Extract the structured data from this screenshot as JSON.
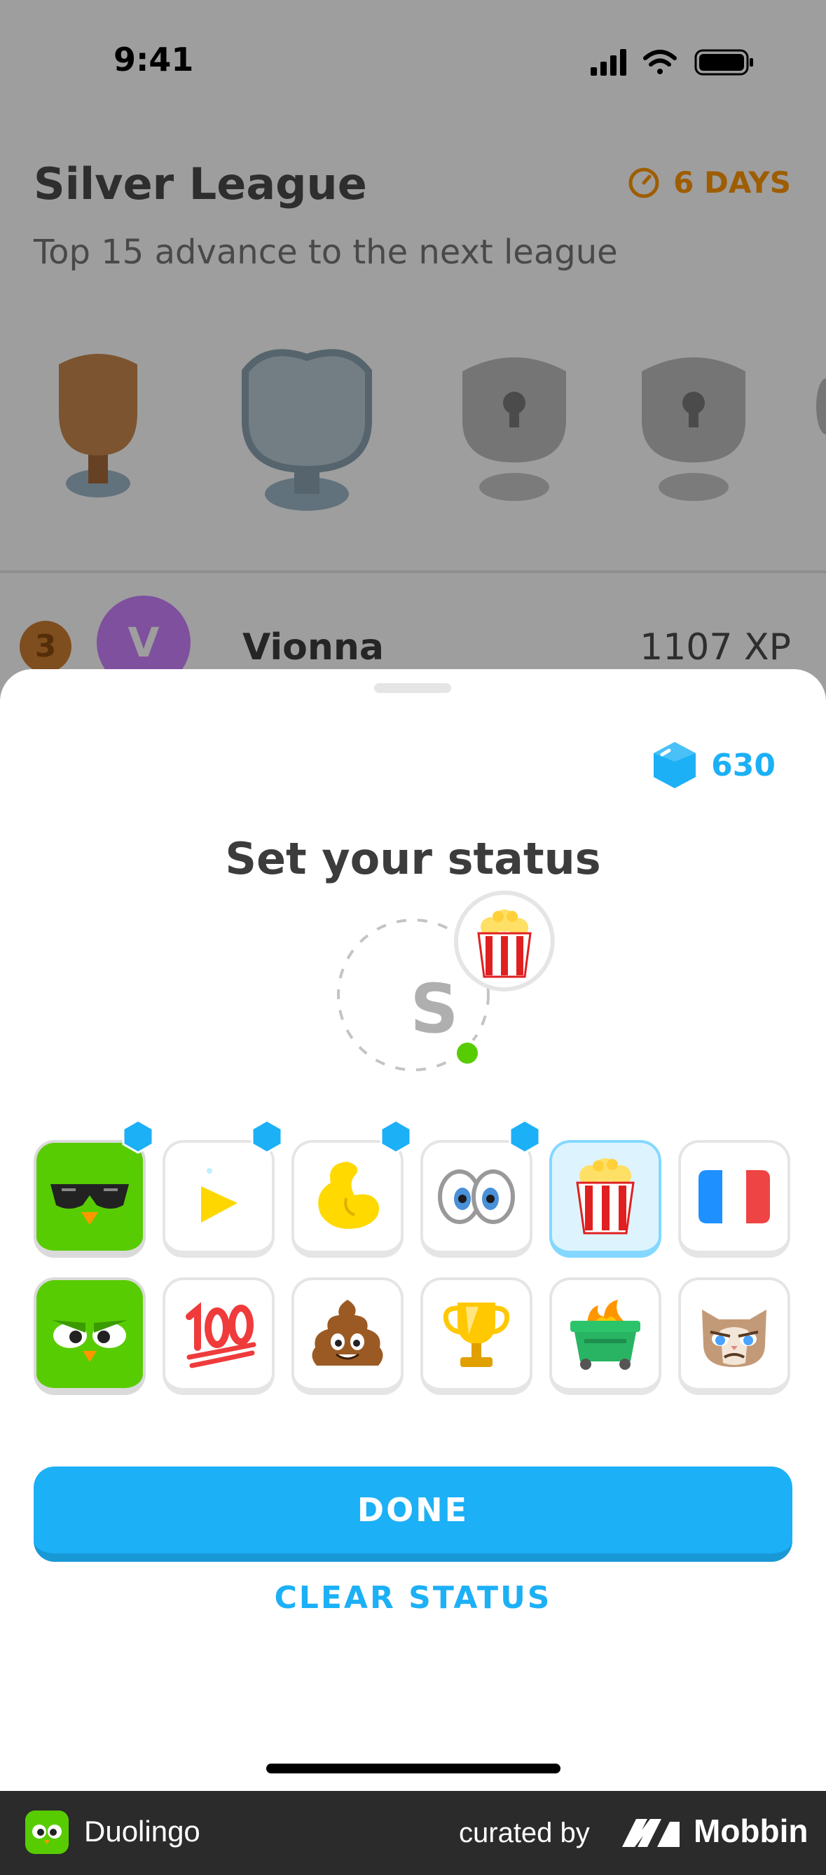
{
  "status_bar": {
    "time": "9:41"
  },
  "league": {
    "title": "Silver League",
    "subtitle": "Top 15 advance to the next league",
    "days_left": "6 DAYS"
  },
  "leaderboard_row": {
    "rank": "3",
    "avatar_letter": "V",
    "name": "Vionna",
    "xp": "1107 XP"
  },
  "sheet": {
    "gems": "630",
    "title": "Set your status",
    "preview_letter": "S",
    "selected_status_icon": "popcorn-icon",
    "statuses": [
      {
        "icon": "duo-sunglasses-icon",
        "premium": true
      },
      {
        "icon": "play-icon",
        "premium": true
      },
      {
        "icon": "flexed-bicep-icon",
        "premium": true
      },
      {
        "icon": "eyes-icon",
        "premium": true
      },
      {
        "icon": "popcorn-icon",
        "selected": true
      },
      {
        "icon": "france-flag-icon"
      },
      {
        "icon": "duo-angry-icon"
      },
      {
        "icon": "hundred-icon"
      },
      {
        "icon": "poop-icon"
      },
      {
        "icon": "trophy-icon"
      },
      {
        "icon": "dumpster-fire-icon"
      },
      {
        "icon": "grumpy-cat-icon"
      }
    ],
    "done_label": "DONE",
    "clear_label": "CLEAR STATUS"
  },
  "footer": {
    "app_name": "Duolingo",
    "curated_by": "curated by",
    "brand": "Mobbin"
  },
  "colors": {
    "accent_blue": "#1cb0f6",
    "orange": "#ff9600",
    "green": "#58cc02",
    "selected_bg": "#ddf4ff"
  }
}
